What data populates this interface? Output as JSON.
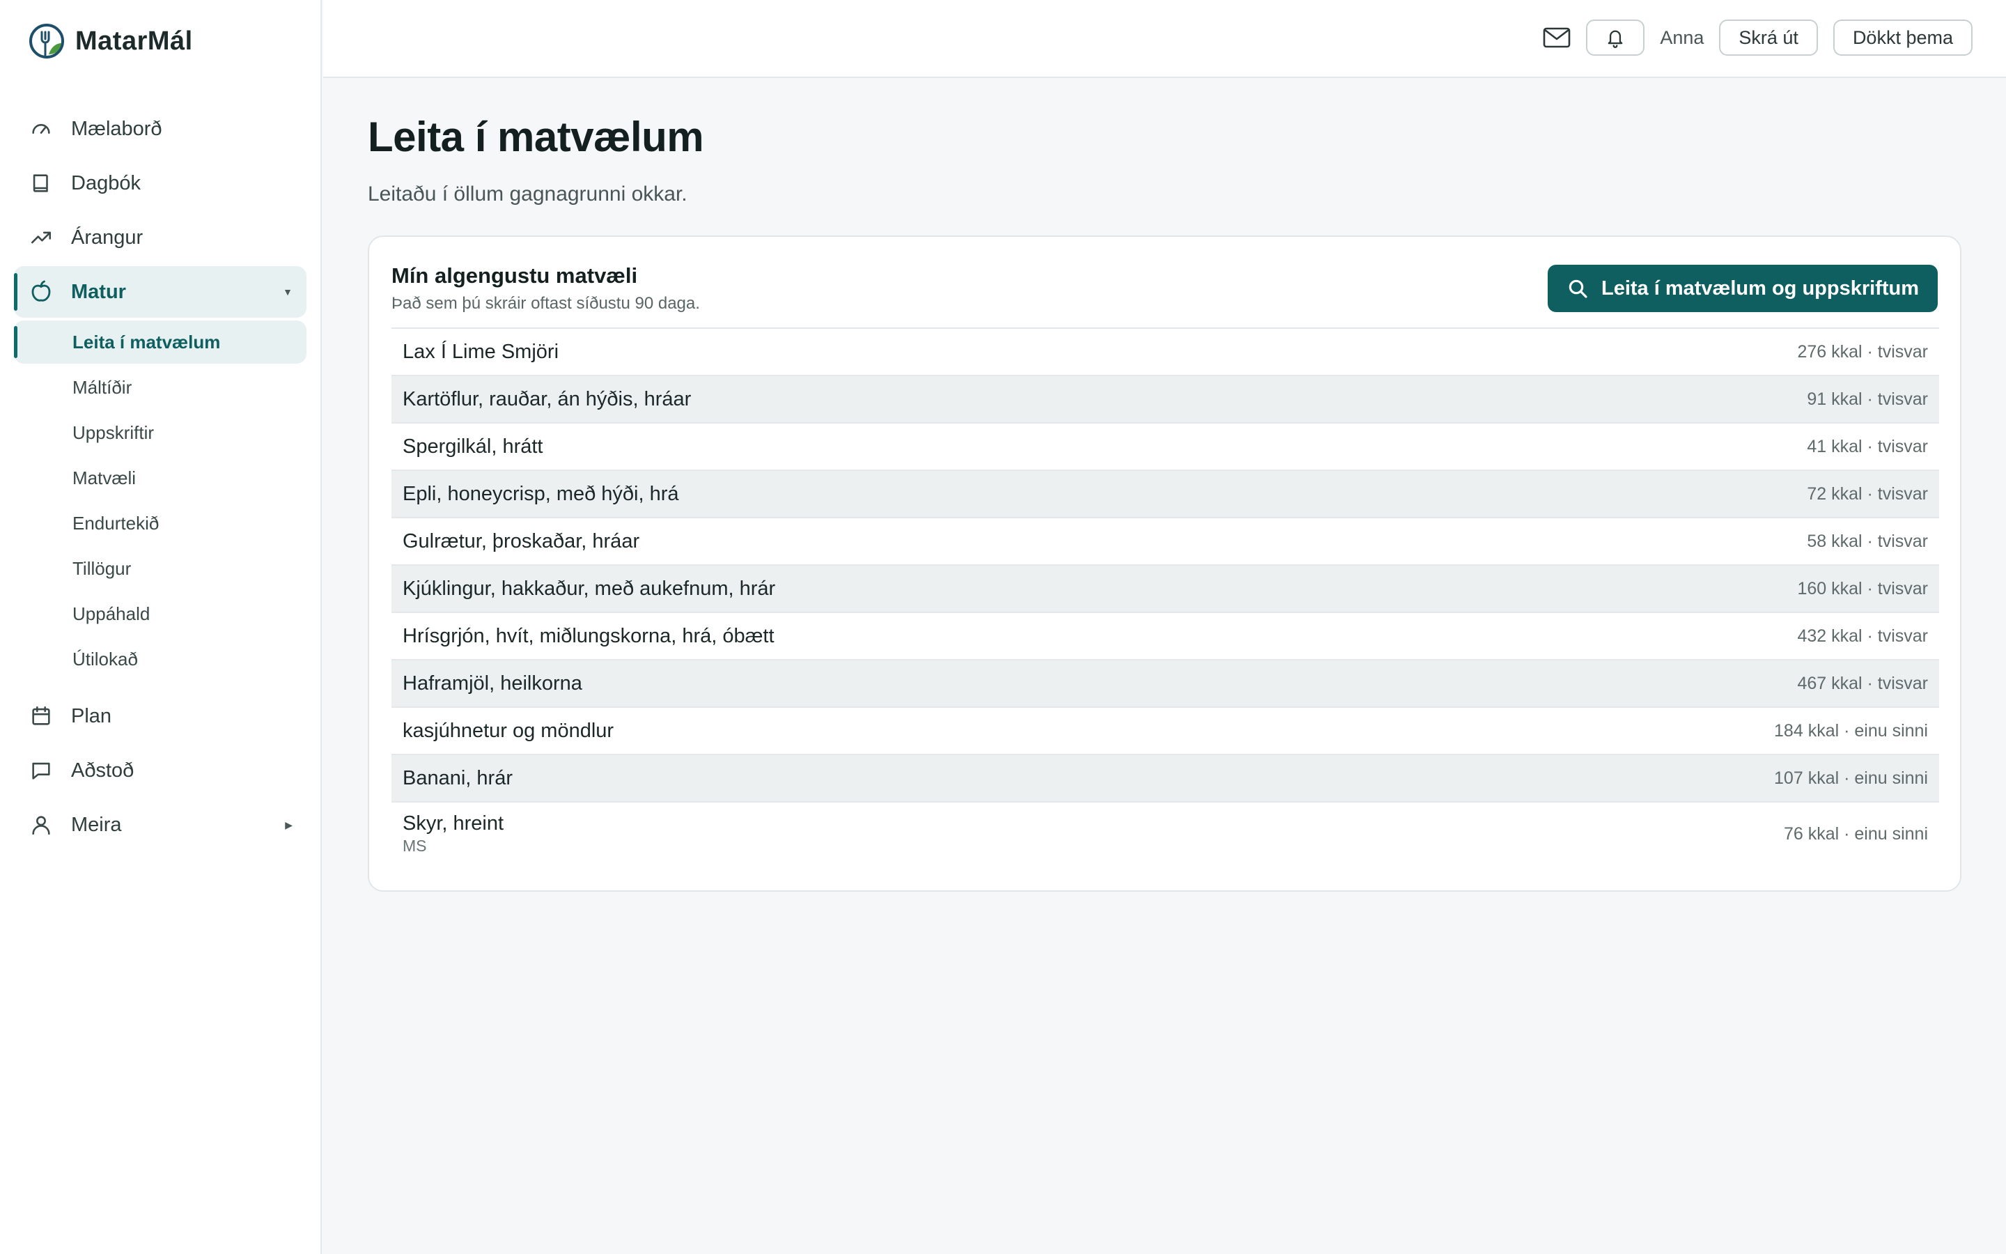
{
  "app": {
    "name": "MatarMál"
  },
  "sidebar": {
    "items": [
      {
        "label": "Mælaborð",
        "icon": "gauge-icon"
      },
      {
        "label": "Dagbók",
        "icon": "book-icon"
      },
      {
        "label": "Árangur",
        "icon": "trend-up-icon"
      },
      {
        "label": "Matur",
        "icon": "apple-icon",
        "active": true,
        "expanded": true
      },
      {
        "label": "Plan",
        "icon": "calendar-icon"
      },
      {
        "label": "Aðstoð",
        "icon": "chat-icon"
      },
      {
        "label": "Meira",
        "icon": "user-icon"
      }
    ],
    "food_sub": [
      {
        "label": "Leita í matvælum",
        "active": true
      },
      {
        "label": "Máltíðir"
      },
      {
        "label": "Uppskriftir"
      },
      {
        "label": "Matvæli"
      },
      {
        "label": "Endurtekið"
      },
      {
        "label": "Tillögur"
      },
      {
        "label": "Uppáhald"
      },
      {
        "label": "Útilokað"
      }
    ]
  },
  "topbar": {
    "username": "Anna",
    "logout_label": "Skrá út",
    "theme_label": "Dökkt þema"
  },
  "page": {
    "title": "Leita í matvælum",
    "subtitle": "Leitaðu í öllum gagnagrunni okkar."
  },
  "card": {
    "title": "Mín algengustu matvæli",
    "subtitle": "Það sem þú skráir oftast síðustu 90 daga.",
    "search_button": "Leita í matvælum og uppskriftum",
    "foods": [
      {
        "name": "Lax Í Lime Smjöri",
        "meta": "276 kkal · tvisvar"
      },
      {
        "name": "Kartöflur, rauðar, án hýðis, hráar",
        "meta": "91 kkal · tvisvar"
      },
      {
        "name": "Spergilkál, hrátt",
        "meta": "41 kkal · tvisvar"
      },
      {
        "name": "Epli, honeycrisp, með hýði, hrá",
        "meta": "72 kkal · tvisvar"
      },
      {
        "name": "Gulrætur, þroskaðar, hráar",
        "meta": "58 kkal · tvisvar"
      },
      {
        "name": "Kjúklingur, hakkaður, með aukefnum, hrár",
        "meta": "160 kkal · tvisvar"
      },
      {
        "name": "Hrísgrjón, hvít, miðlungskorna, hrá, óbætt",
        "meta": "432 kkal · tvisvar"
      },
      {
        "name": "Haframjöl, heilkorna",
        "meta": "467 kkal · tvisvar"
      },
      {
        "name": "kasjúhnetur og möndlur",
        "meta": "184 kkal · einu sinni"
      },
      {
        "name": "Banani, hrár",
        "meta": "107 kkal · einu sinni"
      },
      {
        "name": "Skyr, hreint",
        "brand": "MS",
        "meta": "76 kkal · einu sinni"
      }
    ]
  },
  "colors": {
    "accent": "#0f5e60",
    "active_bg": "#e8f1f1",
    "row_alt": "#ecf0f0"
  }
}
